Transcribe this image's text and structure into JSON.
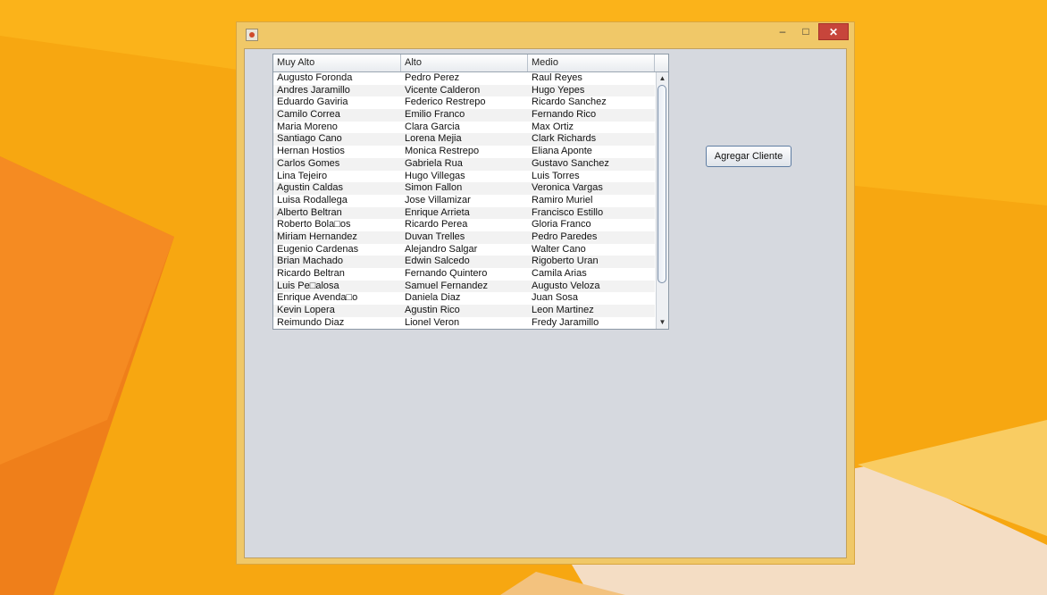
{
  "colors": {
    "desktop_orange": "#f6a313",
    "window_frame": "#f0c868",
    "close_red": "#c7453b",
    "panel_gray": "#d6d9df"
  },
  "window": {
    "icon": "java-app-icon",
    "controls": {
      "minimize": "–",
      "maximize": "□",
      "close": "✕"
    }
  },
  "table": {
    "headers": [
      "Muy Alto",
      "Alto",
      "Medio"
    ],
    "rows": [
      [
        "Augusto Foronda",
        "Pedro Perez",
        "Raul Reyes"
      ],
      [
        "Andres Jaramillo",
        "Vicente Calderon",
        "Hugo Yepes"
      ],
      [
        "Eduardo Gaviria",
        "Federico Restrepo",
        "Ricardo Sanchez"
      ],
      [
        "Camilo Correa",
        "Emilio Franco",
        "Fernando Rico"
      ],
      [
        "Maria Moreno",
        "Clara Garcia",
        "Max Ortiz"
      ],
      [
        "Santiago Cano",
        "Lorena Mejia",
        "Clark Richards"
      ],
      [
        "Hernan Hostios",
        "Monica Restrepo",
        "Eliana Aponte"
      ],
      [
        "Carlos Gomes",
        "Gabriela Rua",
        "Gustavo Sanchez"
      ],
      [
        "Lina Tejeiro",
        "Hugo Villegas",
        "Luis Torres"
      ],
      [
        "Agustin Caldas",
        "Simon Fallon",
        "Veronica Vargas"
      ],
      [
        "Luisa Rodallega",
        "Jose Villamizar",
        "Ramiro Muriel"
      ],
      [
        "Alberto Beltran",
        "Enrique Arrieta",
        "Francisco Estillo"
      ],
      [
        "Roberto Bola□os",
        "Ricardo Perea",
        "Gloria Franco"
      ],
      [
        "Miriam Hernandez",
        "Duvan Trelles",
        "Pedro Paredes"
      ],
      [
        "Eugenio Cardenas",
        "Alejandro Salgar",
        "Walter Cano"
      ],
      [
        "Brian Machado",
        "Edwin Salcedo",
        "Rigoberto Uran"
      ],
      [
        "Ricardo Beltran",
        "Fernando Quintero",
        "Camila Arias"
      ],
      [
        "Luis Pe□alosa",
        "Samuel Fernandez",
        "Augusto Veloza"
      ],
      [
        "Enrique Avenda□o",
        "Daniela Diaz",
        "Juan Sosa"
      ],
      [
        "Kevin Lopera",
        "Agustin Rico",
        "Leon Martinez"
      ],
      [
        "Reimundo Diaz",
        "Lionel Veron",
        "Fredy Jaramillo"
      ]
    ]
  },
  "scrollbar": {
    "up": "▲",
    "down": "▼"
  },
  "buttons": {
    "add_client": "Agregar Cliente"
  }
}
